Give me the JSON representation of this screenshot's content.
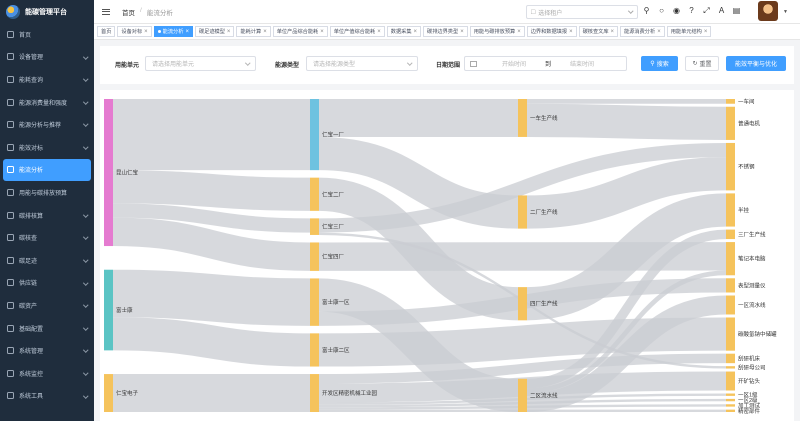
{
  "app": {
    "title": "能碳管理平台"
  },
  "sidebar": {
    "items": [
      {
        "label": "首页",
        "icon": "home-icon",
        "arrow": false
      },
      {
        "label": "设备管理",
        "icon": "device-icon",
        "arrow": true
      },
      {
        "label": "能耗查询",
        "icon": "query-icon",
        "arrow": true
      },
      {
        "label": "能源消费量和强度",
        "icon": "energy-icon",
        "arrow": true
      },
      {
        "label": "能源分析与推荐",
        "icon": "analysis-icon",
        "arrow": true
      },
      {
        "label": "能效对标",
        "icon": "benchmark-icon",
        "arrow": true
      },
      {
        "label": "能流分析",
        "icon": "flow-icon",
        "arrow": false,
        "active": true
      },
      {
        "label": "用能与碳排放预算",
        "icon": "budget-icon",
        "arrow": false
      },
      {
        "label": "碳排核算",
        "icon": "carbon-icon",
        "arrow": true
      },
      {
        "label": "碳核查",
        "icon": "verify-icon",
        "arrow": true
      },
      {
        "label": "碳足迹",
        "icon": "footprint-icon",
        "arrow": true
      },
      {
        "label": "供应链",
        "icon": "supply-icon",
        "arrow": true
      },
      {
        "label": "碳资产",
        "icon": "asset-icon",
        "arrow": true
      },
      {
        "label": "基础配置",
        "icon": "config-icon",
        "arrow": true
      },
      {
        "label": "系统管理",
        "icon": "system-icon",
        "arrow": true
      },
      {
        "label": "系统监控",
        "icon": "monitor-icon",
        "arrow": true
      },
      {
        "label": "系统工具",
        "icon": "tools-icon",
        "arrow": true
      }
    ]
  },
  "header": {
    "breadcrumb": [
      "首页",
      "能流分析"
    ],
    "tenant_placeholder": "选择租户",
    "icons": [
      "search-icon",
      "help-icon",
      "github-icon",
      "question-icon",
      "fullscreen-icon",
      "font-size-icon",
      "theme-icon"
    ]
  },
  "tags": [
    {
      "label": "首页",
      "closable": false
    },
    {
      "label": "设备对标",
      "closable": true
    },
    {
      "label": "能流分析",
      "closable": true,
      "active": true
    },
    {
      "label": "碳足迹模型",
      "closable": true
    },
    {
      "label": "能耗计算",
      "closable": true
    },
    {
      "label": "单位产品综合能耗",
      "closable": true
    },
    {
      "label": "单位产值综合能耗",
      "closable": true
    },
    {
      "label": "数据采集",
      "closable": true
    },
    {
      "label": "碳排边界类型",
      "closable": true
    },
    {
      "label": "用能与碳排放预算",
      "closable": true
    },
    {
      "label": "边界和数据填报",
      "closable": true
    },
    {
      "label": "碳核查文库",
      "closable": true
    },
    {
      "label": "能源消费分析",
      "closable": true
    },
    {
      "label": "用能单元结构",
      "closable": true
    }
  ],
  "search": {
    "unit_label": "用能单元",
    "unit_placeholder": "请选择用能单元",
    "type_label": "能源类型",
    "type_placeholder": "请选择能源类型",
    "date_label": "日期范围",
    "date_start": "开始时间",
    "date_sep": "到",
    "date_end": "结束时间",
    "search_btn": "搜索",
    "reset_btn": "重置",
    "balance_btn": "能效平衡与优化"
  },
  "chart_data": {
    "type": "sankey",
    "nodes": [
      "昆山仁宝",
      "富士康",
      "仁宝电子",
      "仁宝一厂",
      "仁宝二厂",
      "仁宝三厂",
      "仁宝四厂",
      "富士康一区",
      "富士康二区",
      "开发区精密机械工业园",
      "一车生产线",
      "二厂生产线",
      "四厂生产线",
      "二区流水线",
      "一车间",
      "普通电机",
      "不锈钢",
      "半挂",
      "三厂生产线",
      "笔记本电脑",
      "表型测量仪",
      "一区流水线",
      "碳酸氢钠中储罐",
      "刮研机床",
      "刮研母公司",
      "开矿钻头",
      "一区1级",
      "一区2级",
      "加工测试",
      "精密部件"
    ],
    "colors": {
      "昆山仁宝": "#e57bd0",
      "富士康": "#5bc4c4",
      "仁宝电子": "#f5c35c",
      "仁宝一厂": "#6ec2e0",
      "level2": "#f5c35c",
      "link": "#c9ccd1"
    },
    "links": [
      {
        "source": "昆山仁宝",
        "target": "仁宝一厂",
        "value": 30
      },
      {
        "source": "昆山仁宝",
        "target": "仁宝二厂",
        "value": 14
      },
      {
        "source": "昆山仁宝",
        "target": "仁宝三厂",
        "value": 6
      },
      {
        "source": "昆山仁宝",
        "target": "仁宝四厂",
        "value": 12
      },
      {
        "source": "富士康",
        "target": "富士康一区",
        "value": 20
      },
      {
        "source": "富士康",
        "target": "富士康二区",
        "value": 14
      },
      {
        "source": "仁宝电子",
        "target": "开发区精密机械工业园",
        "value": 16
      },
      {
        "source": "仁宝一厂",
        "target": "一车生产线",
        "value": 16
      },
      {
        "source": "仁宝一厂",
        "target": "二厂生产线",
        "value": 14
      },
      {
        "source": "仁宝二厂",
        "target": "四厂生产线",
        "value": 14
      },
      {
        "source": "仁宝三厂",
        "target": "不锈钢",
        "value": 6
      },
      {
        "source": "仁宝四厂",
        "target": "笔记本电脑",
        "value": 12
      },
      {
        "source": "富士康一区",
        "target": "二区流水线",
        "value": 14
      },
      {
        "source": "富士康一区",
        "target": "表型测量仪",
        "value": 6
      },
      {
        "source": "富士康二区",
        "target": "碳酸氢钠中储罐",
        "value": 14
      },
      {
        "source": "开发区精密机械工业园",
        "target": "刮研机床",
        "value": 4
      },
      {
        "source": "开发区精密机械工业园",
        "target": "开矿钻头",
        "value": 8
      },
      {
        "source": "开发区精密机械工业园",
        "target": "一区1级",
        "value": 1
      },
      {
        "source": "开发区精密机械工业园",
        "target": "一区2级",
        "value": 1
      },
      {
        "source": "开发区精密机械工业园",
        "target": "加工测试",
        "value": 1
      },
      {
        "source": "开发区精密机械工业园",
        "target": "精密部件",
        "value": 1
      },
      {
        "source": "一车生产线",
        "target": "一车间",
        "value": 2
      },
      {
        "source": "一车生产线",
        "target": "普通电机",
        "value": 14
      },
      {
        "source": "二厂生产线",
        "target": "不锈钢",
        "value": 14
      },
      {
        "source": "四厂生产线",
        "target": "半挂",
        "value": 14
      },
      {
        "source": "二区流水线",
        "target": "三厂生产线",
        "value": 4
      },
      {
        "source": "二区流水线",
        "target": "笔记本电脑",
        "value": 2
      },
      {
        "source": "二区流水线",
        "target": "一区流水线",
        "value": 8
      },
      {
        "source": "仁宝三厂",
        "target": "刮研母公司",
        "value": 1
      }
    ]
  }
}
